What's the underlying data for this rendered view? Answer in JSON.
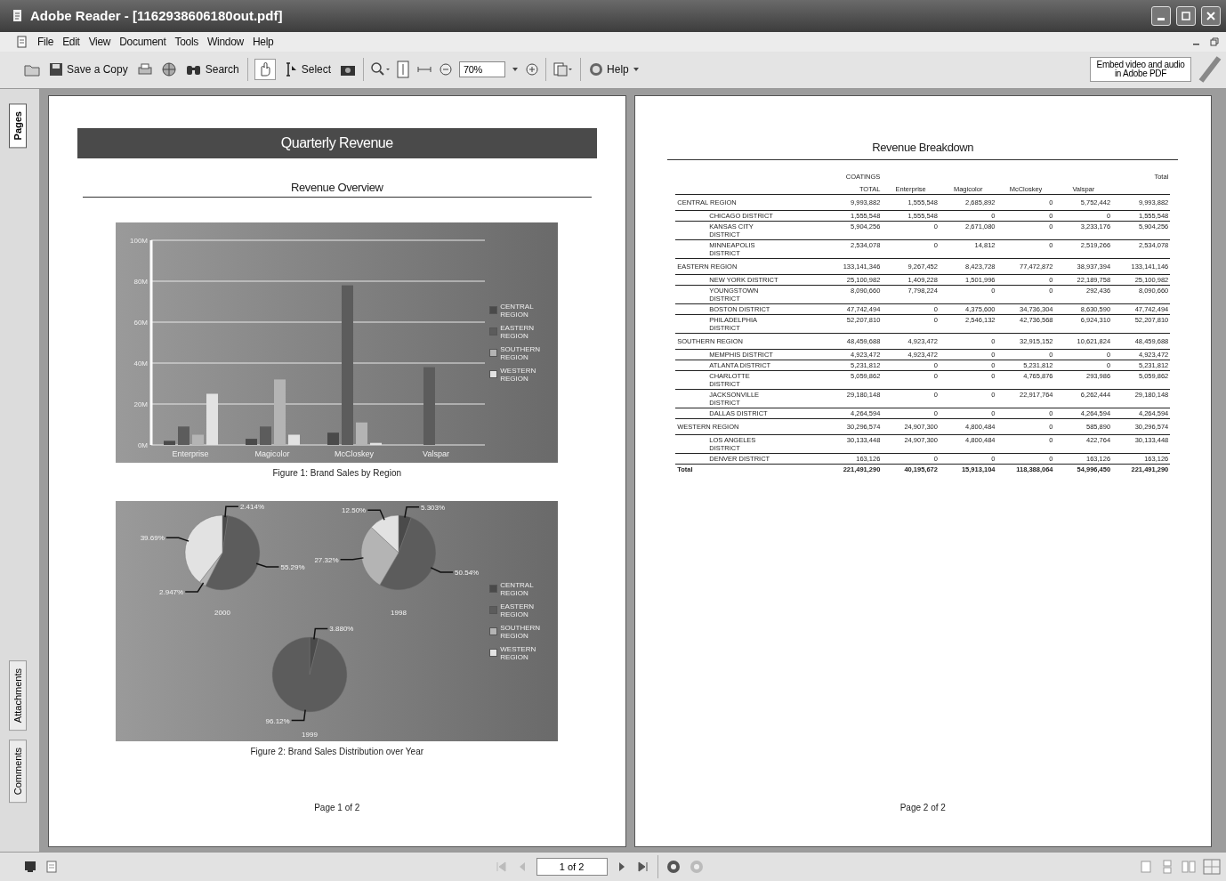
{
  "window": {
    "title": "Adobe Reader - [1162938606180out.pdf]"
  },
  "menu": [
    "File",
    "Edit",
    "View",
    "Document",
    "Tools",
    "Window",
    "Help"
  ],
  "toolbar": {
    "save_copy": "Save a Copy",
    "search": "Search",
    "select": "Select",
    "zoom": "70%",
    "help": "Help",
    "promo": "Embed video and audio in Adobe PDF"
  },
  "side_tabs": [
    {
      "label": "Pages",
      "selected": true
    },
    {
      "label": "Attachments",
      "selected": false
    },
    {
      "label": "Comments",
      "selected": false
    }
  ],
  "page1": {
    "banner": "Quarterly Revenue",
    "heading": "Revenue Overview",
    "figure1": {
      "caption": "Figure 1: Brand Sales by Region",
      "chart_data": {
        "type": "bar",
        "grid": true,
        "legend": "right",
        "categories": [
          "Enterprise",
          "Magicolor",
          "McCloskey",
          "Valspar"
        ],
        "yticks": [
          {
            "value": 0,
            "label": "0M"
          },
          {
            "value": 20,
            "label": "20M"
          },
          {
            "value": 40,
            "label": "40M"
          },
          {
            "value": 60,
            "label": "60M"
          },
          {
            "value": 80,
            "label": "80M"
          },
          {
            "value": 100,
            "label": "100M"
          }
        ],
        "ylim": [
          0,
          100
        ],
        "series": [
          {
            "name": "CENTRAL REGION",
            "color": "#4a4a4a",
            "values": [
              2,
              3,
              6,
              null
            ]
          },
          {
            "name": "EASTERN REGION",
            "color": "#5c5c5c",
            "values": [
              9,
              9,
              78,
              38
            ]
          },
          {
            "name": "SOUTHERN REGION",
            "color": "#b4b4b4",
            "values": [
              5,
              32,
              11,
              null
            ]
          },
          {
            "name": "WESTERN REGION",
            "color": "#e2e2e2",
            "values": [
              25,
              5,
              1,
              null
            ]
          }
        ]
      }
    },
    "figure2": {
      "caption": "Figure 2: Brand Sales Distribution over Year",
      "legend": [
        {
          "name": "CENTRAL REGION",
          "color": "#4a4a4a"
        },
        {
          "name": "EASTERN REGION",
          "color": "#5c5c5c"
        },
        {
          "name": "SOUTHERN REGION",
          "color": "#b4b4b4"
        },
        {
          "name": "WESTERN REGION",
          "color": "#e2e2e2"
        }
      ],
      "pies": [
        {
          "chart_data": {
            "type": "pie",
            "title": "2000",
            "values": [
              2.414,
              55.29,
              2.947,
              39.69
            ],
            "value_labels": [
              "2.414%",
              "55.29%",
              "2.947%",
              "39.69%"
            ]
          }
        },
        {
          "chart_data": {
            "type": "pie",
            "title": "1998",
            "values": [
              5.303,
              50.54,
              27.32,
              12.5
            ],
            "value_labels": [
              "5.303%",
              "50.54%",
              "27.32%",
              "12.50%"
            ]
          }
        },
        {
          "chart_data": {
            "type": "pie",
            "title": "1999",
            "values": [
              3.88,
              96.12
            ],
            "value_labels": [
              "3.880%",
              "96.12%"
            ]
          }
        }
      ]
    },
    "footer": "Page 1 of 2"
  },
  "page2": {
    "title": "Revenue Breakdown",
    "group_header": "COATINGS",
    "total_header": "Total",
    "columns": [
      "TOTAL",
      "Enterprise",
      "Magicolor",
      "McCloskey",
      "Valspar"
    ],
    "regions": [
      {
        "name": "CENTRAL REGION",
        "values": [
          "9,993,882",
          "1,555,548",
          "2,685,892",
          "0",
          "5,752,442",
          "9,993,882"
        ],
        "children": [
          {
            "name": "CHICAGO DISTRICT",
            "values": [
              "1,555,548",
              "1,555,548",
              "0",
              "0",
              "0",
              "1,555,548"
            ]
          },
          {
            "name": "KANSAS CITY DISTRICT",
            "values": [
              "5,904,256",
              "0",
              "2,671,080",
              "0",
              "3,233,176",
              "5,904,256"
            ]
          },
          {
            "name": "MINNEAPOLIS DISTRICT",
            "values": [
              "2,534,078",
              "0",
              "14,812",
              "0",
              "2,519,266",
              "2,534,078"
            ]
          }
        ]
      },
      {
        "name": "EASTERN REGION",
        "values": [
          "133,141,346",
          "9,267,452",
          "8,423,728",
          "77,472,872",
          "38,937,394",
          "133,141,146"
        ],
        "children": [
          {
            "name": "NEW YORK DISTRICT",
            "values": [
              "25,100,982",
              "1,409,228",
              "1,501,996",
              "0",
              "22,189,758",
              "25,100,982"
            ]
          },
          {
            "name": "YOUNGSTOWN DISTRICT",
            "values": [
              "8,090,660",
              "7,798,224",
              "0",
              "0",
              "292,436",
              "8,090,660"
            ]
          },
          {
            "name": "BOSTON DISTRICT",
            "values": [
              "47,742,494",
              "0",
              "4,375,600",
              "34,736,304",
              "8,630,590",
              "47,742,494"
            ]
          },
          {
            "name": "PHILADELPHIA DISTRICT",
            "values": [
              "52,207,810",
              "0",
              "2,546,132",
              "42,736,568",
              "6,924,310",
              "52,207,810"
            ]
          }
        ]
      },
      {
        "name": "SOUTHERN REGION",
        "values": [
          "48,459,688",
          "4,923,472",
          "0",
          "32,915,152",
          "10,621,824",
          "48,459,688"
        ],
        "children": [
          {
            "name": "MEMPHIS DISTRICT",
            "values": [
              "4,923,472",
              "4,923,472",
              "0",
              "0",
              "0",
              "4,923,472"
            ]
          },
          {
            "name": "ATLANTA DISTRICT",
            "values": [
              "5,231,812",
              "0",
              "0",
              "5,231,812",
              "0",
              "5,231,812"
            ]
          },
          {
            "name": "CHARLOTTE DISTRICT",
            "values": [
              "5,059,862",
              "0",
              "0",
              "4,765,876",
              "293,986",
              "5,059,862"
            ]
          },
          {
            "name": "JACKSONVILLE DISTRICT",
            "values": [
              "29,180,148",
              "0",
              "0",
              "22,917,764",
              "6,262,444",
              "29,180,148"
            ]
          },
          {
            "name": "DALLAS DISTRICT",
            "values": [
              "4,264,594",
              "0",
              "0",
              "0",
              "4,264,594",
              "4,264,594"
            ]
          }
        ]
      },
      {
        "name": "WESTERN REGION",
        "values": [
          "30,296,574",
          "24,907,300",
          "4,800,484",
          "0",
          "585,890",
          "30,296,574"
        ],
        "children": [
          {
            "name": "LOS ANGELES DISTRICT",
            "values": [
              "30,133,448",
              "24,907,300",
              "4,800,484",
              "0",
              "422,764",
              "30,133,448"
            ]
          },
          {
            "name": "DENVER DISTRICT",
            "values": [
              "163,126",
              "0",
              "0",
              "0",
              "163,126",
              "163,126"
            ]
          }
        ]
      }
    ],
    "total": {
      "name": "Total",
      "values": [
        "221,491,290",
        "40,195,672",
        "15,913,104",
        "118,388,064",
        "54,996,450",
        "221,491,290"
      ]
    },
    "footer": "Page 2 of 2"
  },
  "status_bar": {
    "page": "1 of 2"
  }
}
